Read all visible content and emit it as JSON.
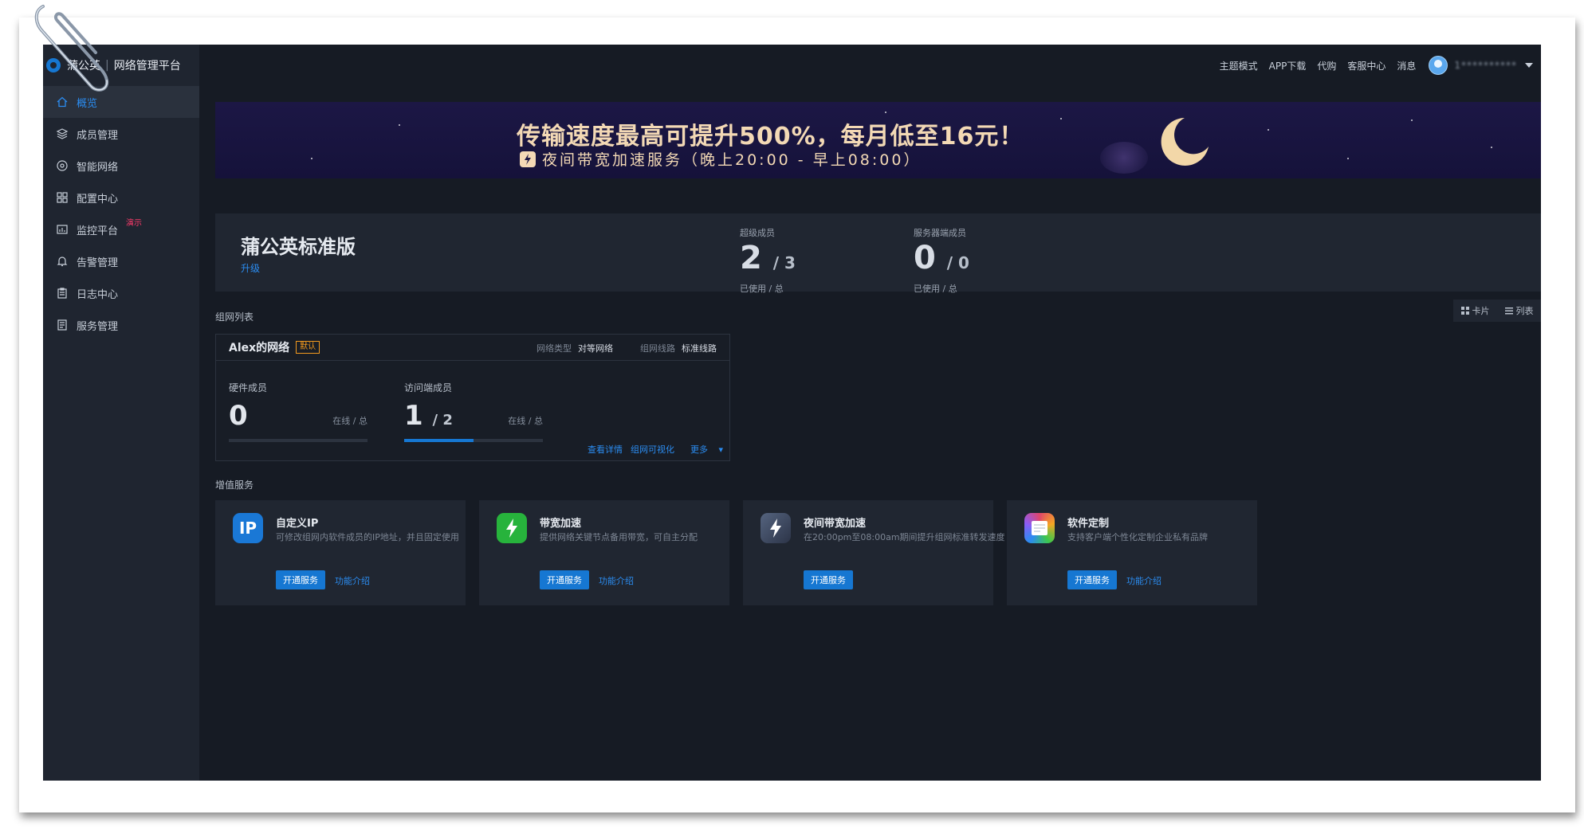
{
  "brand": {
    "name": "蒲公英",
    "product": "网络管理平台"
  },
  "sidebar": {
    "items": [
      {
        "label": "概览",
        "icon": "home-icon",
        "active": true
      },
      {
        "label": "成员管理",
        "icon": "layers-icon"
      },
      {
        "label": "智能网络",
        "icon": "network-icon"
      },
      {
        "label": "配置中心",
        "icon": "grid-icon"
      },
      {
        "label": "监控平台",
        "icon": "monitor-icon",
        "badge": "演示"
      },
      {
        "label": "告警管理",
        "icon": "bell-icon"
      },
      {
        "label": "日志中心",
        "icon": "clipboard-icon"
      },
      {
        "label": "服务管理",
        "icon": "document-icon"
      }
    ]
  },
  "topbar": {
    "links": [
      "主题模式",
      "APP下载",
      "代购",
      "客服中心",
      "消息"
    ],
    "username": "1**********"
  },
  "banner": {
    "line1": "传输速度最高可提升500%，每月低至16元！",
    "line2": "夜间带宽加速服务（晚上20:00 - 早上08:00）"
  },
  "plan": {
    "title": "蒲公英标准版",
    "upgrade": "升级",
    "stats": [
      {
        "label": "超级成员",
        "used": "2",
        "total": "/ 3",
        "sub": "已使用 / 总"
      },
      {
        "label": "服务器端成员",
        "used": "0",
        "total": "/ 0",
        "sub": "已使用 / 总"
      }
    ]
  },
  "network_section": {
    "label": "组网列表",
    "view_card": "卡片",
    "view_list": "列表"
  },
  "network_card": {
    "name": "Alex的网络",
    "tag": "默认",
    "type_key": "网络类型",
    "type_value": "对等网络",
    "route_key": "组网线路",
    "route_value": "标准线路",
    "members": [
      {
        "label": "硬件成员",
        "online": "0",
        "total": "",
        "hint": "在线 / 总",
        "fill": 0
      },
      {
        "label": "访问端成员",
        "online": "1",
        "total": "/ 2",
        "hint": "在线 / 总",
        "fill": 0.5
      }
    ],
    "links": [
      "查看详情",
      "组网可视化",
      "更多"
    ]
  },
  "services": {
    "label": "增值服务",
    "btn_label": "开通服务",
    "link_label": "功能介绍",
    "items": [
      {
        "name": "自定义IP",
        "desc": "可修改组网内软件成员的IP地址，并且固定使用",
        "icon_text": "IP",
        "color": "#1a78d6",
        "has_link": true
      },
      {
        "name": "带宽加速",
        "desc": "提供网络关键节点备用带宽，可自主分配",
        "icon_text": "",
        "color": "#27b33c",
        "has_link": true
      },
      {
        "name": "夜间带宽加速",
        "desc": "在20:00pm至08:00am期间提升组网标准转发速度",
        "icon_text": "",
        "color": "#3e4a63",
        "has_link": false
      },
      {
        "name": "软件定制",
        "desc": "支持客户端个性化定制企业私有品牌",
        "icon_text": "",
        "color": "#e0456b",
        "has_link": true
      }
    ]
  },
  "colors": {
    "accent": "#1677d2",
    "link": "#2b8cf0",
    "warning": "#f39a1e",
    "banner_text": "#f3d9b5"
  }
}
